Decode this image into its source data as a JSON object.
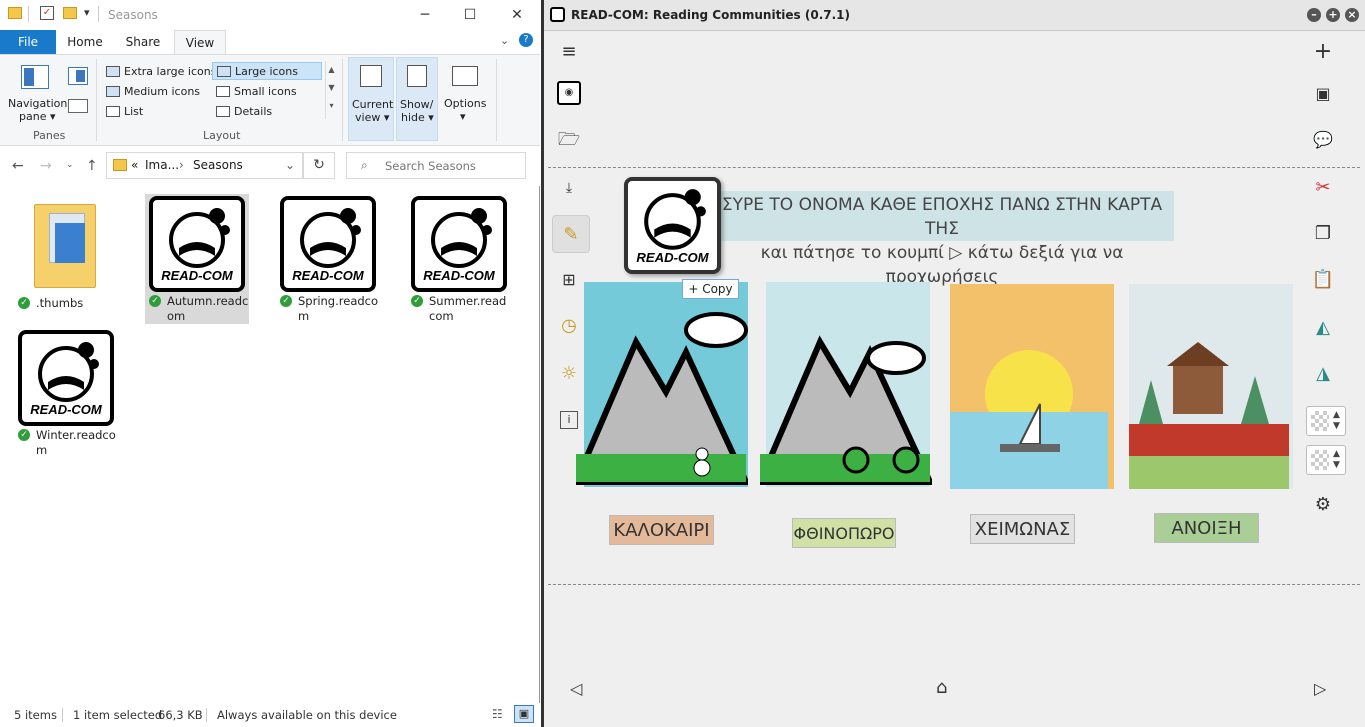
{
  "explorer": {
    "title": "Seasons",
    "tabs": [
      "File",
      "Home",
      "Share",
      "View"
    ],
    "ribbon": {
      "panes": {
        "nav_pane_label_1": "Navigation",
        "nav_pane_label_2": "pane",
        "group_label": "Panes"
      },
      "layout": {
        "items": [
          "Extra large icons",
          "Large icons",
          "Medium icons",
          "Small icons",
          "List",
          "Details"
        ],
        "selected": "Large icons",
        "group_label": "Layout"
      },
      "current_view": {
        "line1": "Current",
        "line2": "view"
      },
      "show_hide": {
        "line1": "Show/",
        "line2": "hide"
      },
      "options": "Options"
    },
    "address": {
      "prefix": "«",
      "crumb1": "Ima...",
      "separator": "›",
      "crumb2": "Seasons"
    },
    "search_placeholder": "Search Seasons",
    "files": [
      {
        "name": ".thumbs",
        "type": "folder"
      },
      {
        "name": "Autumn.readcom",
        "type": "readcom"
      },
      {
        "name": "Spring.readcom",
        "type": "readcom"
      },
      {
        "name": "Summer.readcom",
        "type": "readcom"
      },
      {
        "name": "Winter.readcom",
        "type": "readcom"
      }
    ],
    "status": {
      "count": "5 items",
      "selected": "1 item selected",
      "size": "66,3 KB",
      "availability": "Always available on this device"
    }
  },
  "readcom": {
    "title": "READ-COM: Reading Communities (0.7.1)",
    "logo_text": "READ-COM",
    "instruction_line1": "ΣΥΡΕ ΤΟ ΟΝΟΜΑ ΚΑΘΕ ΕΠΟΧΗΣ ΠΑΝΩ ΣΤΗΝ ΚΑΡΤΑ ΤΗΣ",
    "instruction_line2": "και πάτησε το κουμπί ▷ κάτω δεξιά για να προχωρήσεις",
    "copy_tooltip": "+ Copy",
    "labels": [
      {
        "text": "ΚΑΛΟΚΑΙΡΙ",
        "color": "#e4b99a"
      },
      {
        "text": "ΦΘΙΝΟΠΩΡΟ",
        "color": "#cfe1a4"
      },
      {
        "text": "ΧΕΙΜΩΝΑΣ",
        "color": "#e2e2e2"
      },
      {
        "text": "ΑΝΟΙΞΗ",
        "color": "#a9cf97"
      }
    ]
  }
}
